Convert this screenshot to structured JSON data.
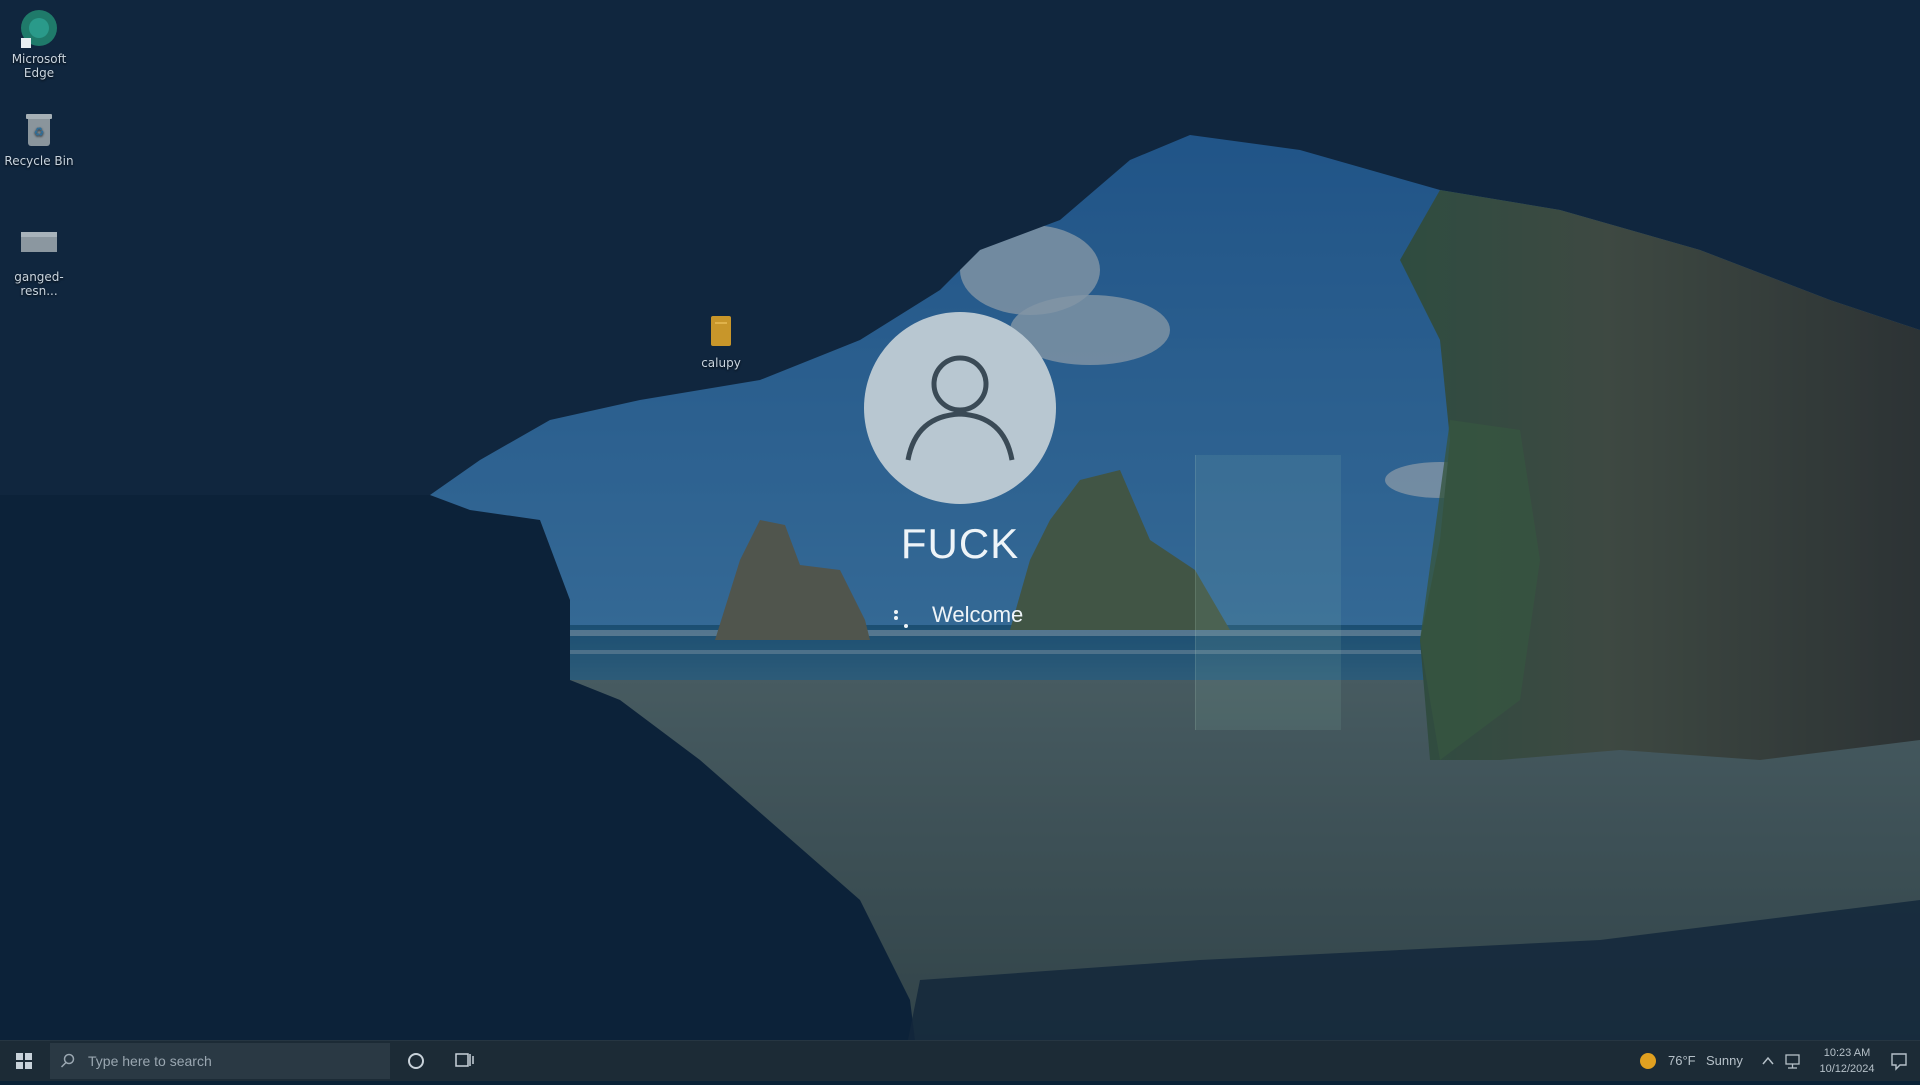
{
  "desktop": {
    "icons": [
      {
        "label": "Microsoft Edge",
        "icon": "edge-icon"
      },
      {
        "label": "Recycle Bin",
        "icon": "recycle-bin-icon"
      },
      {
        "label": "ganged-resn...",
        "icon": "file-icon"
      },
      {
        "label": "calupy",
        "icon": "folder-icon"
      }
    ]
  },
  "welcome": {
    "username": "FUCK",
    "status": "Welcome",
    "avatar_icon": "user-avatar-icon"
  },
  "taskbar": {
    "search_placeholder": "Type here to search",
    "weather": {
      "temperature": "76°F",
      "condition": "Sunny"
    },
    "clock": {
      "time": "10:23 AM",
      "date": "10/12/2024"
    }
  },
  "colors": {
    "tint": "#0b3250",
    "taskbar": "#1c2b36",
    "avatar": "#b8c7d1"
  }
}
